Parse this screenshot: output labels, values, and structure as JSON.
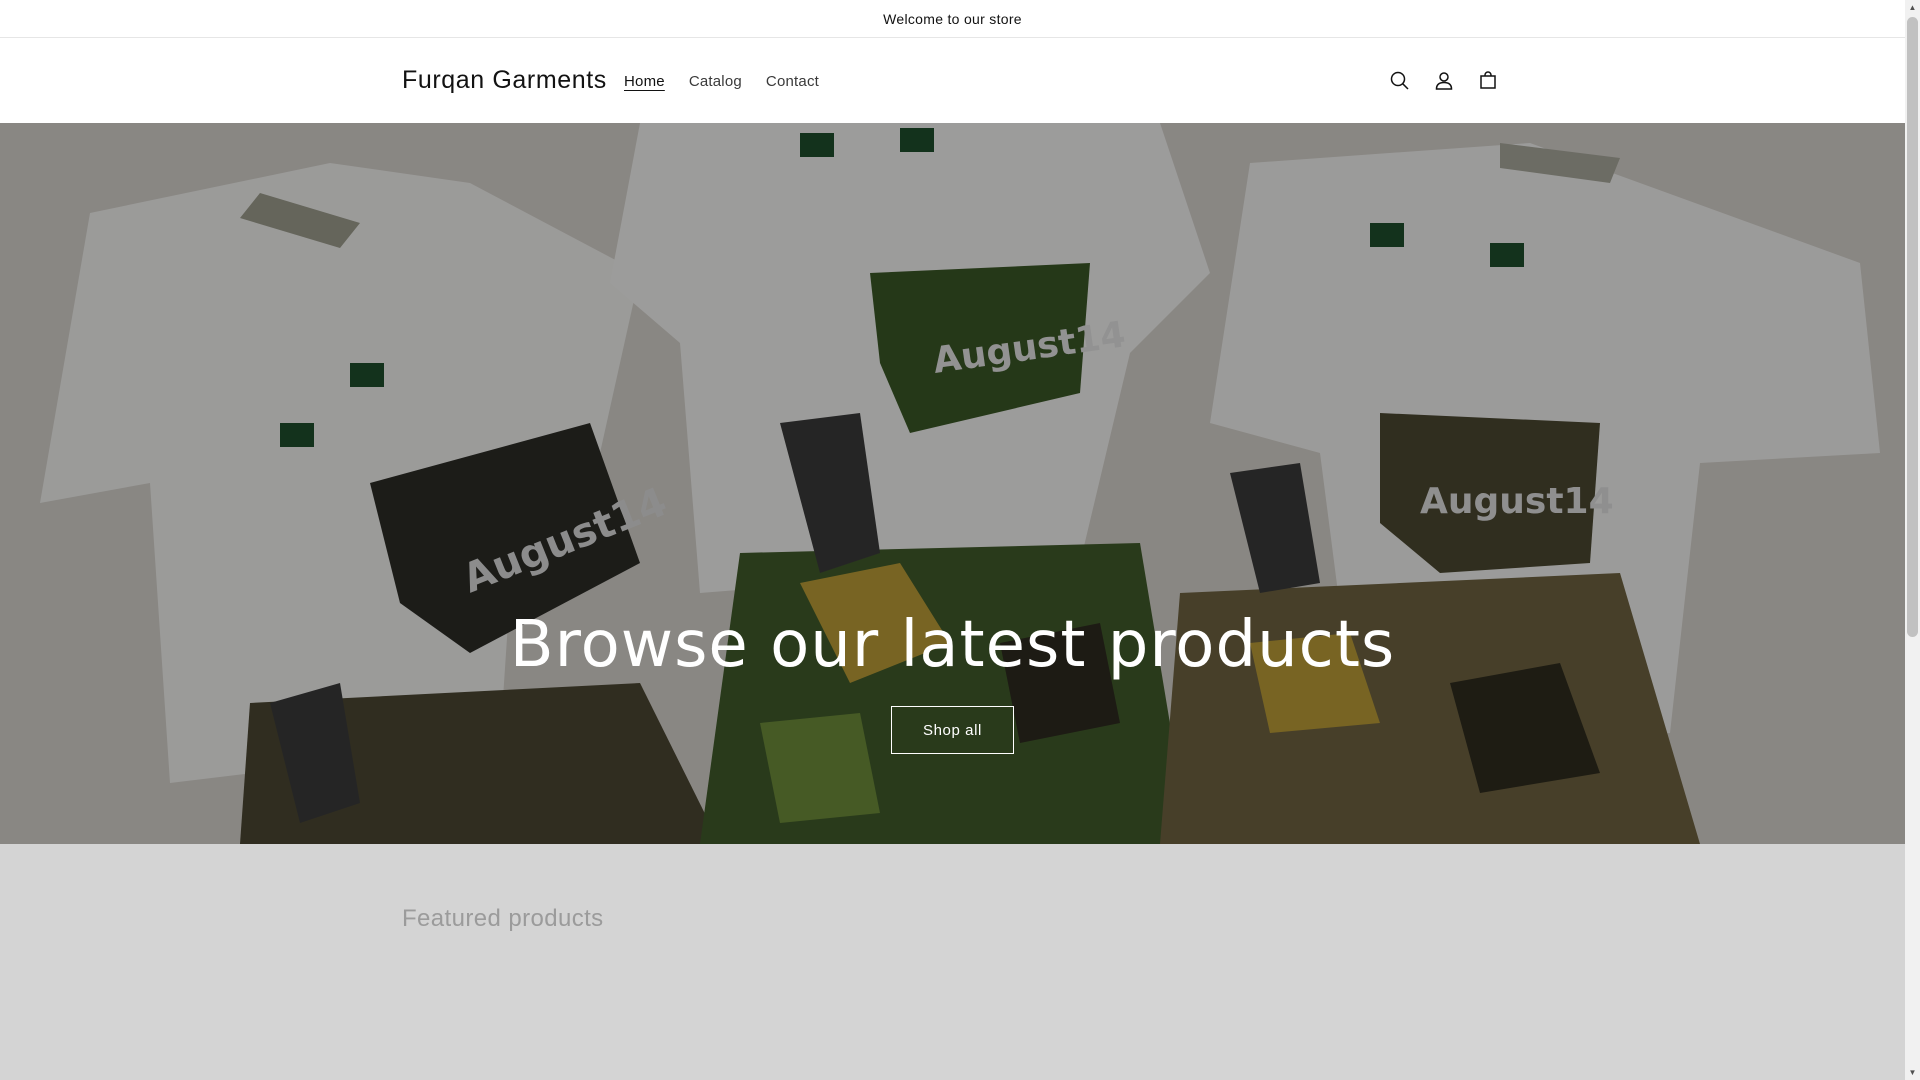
{
  "announcement": {
    "text": "Welcome to our store"
  },
  "header": {
    "logo": "Furqan Garments",
    "nav": [
      {
        "label": "Home",
        "active": true
      },
      {
        "label": "Catalog",
        "active": false
      },
      {
        "label": "Contact",
        "active": false
      }
    ],
    "icons": [
      "search-icon",
      "account-icon",
      "cart-icon"
    ]
  },
  "hero": {
    "title": "Browse our latest products",
    "button_label": "Shop all",
    "image_text": "August14"
  },
  "featured": {
    "title": "Featured products"
  },
  "colors": {
    "text": "#121212",
    "featured_bg": "#d4d4d4",
    "featured_title": "#9b9b9b",
    "camo_green": "#3f5a2a",
    "camo_yellow": "#b99a36"
  }
}
